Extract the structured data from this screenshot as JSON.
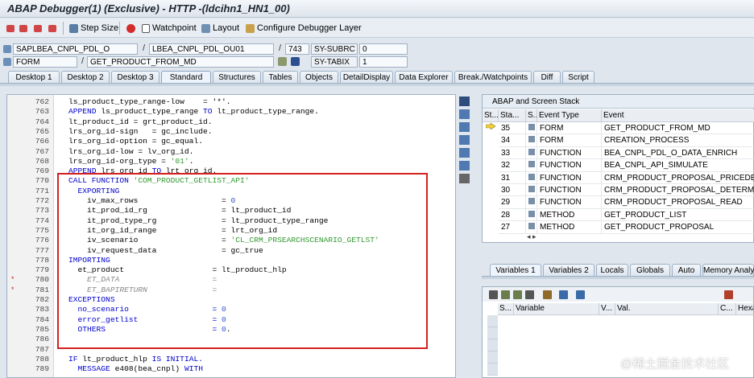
{
  "window": {
    "title": "ABAP Debugger(1)  (Exclusive) - HTTP -(ldcihn1_HN1_00)"
  },
  "toolbar": {
    "step_size": "Step Size",
    "watchpoint": "Watchpoint",
    "layout": "Layout",
    "configure": "Configure Debugger Layer"
  },
  "fields": {
    "program": "SAPLBEA_CNPL_PDL_O",
    "include": "LBEA_CNPL_PDL_OU01",
    "line": "743",
    "subrc_label": "SY-SUBRC",
    "subrc_value": "0",
    "event_type": "FORM",
    "event_name": "GET_PRODUCT_FROM_MD",
    "tabix_label": "SY-TABIX",
    "tabix_value": "1"
  },
  "tabs": [
    "Desktop 1",
    "Desktop 2",
    "Desktop 3",
    "Standard",
    "Structures",
    "Tables",
    "Objects",
    "DetailDisplay",
    "Data Explorer",
    "Break./Watchpoints",
    "Diff",
    "Script"
  ],
  "code": {
    "l762": "762",
    "t762": "ls_product_type_range-low    = '*'.",
    "l763": "763",
    "t763a": "APPEND",
    "t763b": " ls_product_type_range ",
    "t763c": "TO",
    "t763d": " lt_product_type_range.",
    "l764": "764",
    "t764": "lt_product_id = grt_product_id.",
    "l765": "765",
    "t765": "lrs_org_id-sign   = gc_include.",
    "l766": "766",
    "t766": "lrs_org_id-option = gc_equal.",
    "l767": "767",
    "t767": "lrs_org_id-low = lv_org_id.",
    "l768": "768",
    "t768a": "lrs_org_id-org_type = ",
    "t768b": "'01'",
    "t768c": ".",
    "l769": "769",
    "t769a": "APPEND",
    "t769b": " lrs_org_id ",
    "t769c": "TO",
    "t769d": " lrt_org_id.",
    "l770": "770",
    "t770a": "CALL FUNCTION",
    "t770b": " 'COM_PRODUCT_GETLIST_API'",
    "l771": "771",
    "t771": "  EXPORTING",
    "l772": "772",
    "t772a": "    iv_max_rows                  = ",
    "t772b": "0",
    "l773": "773",
    "t773": "    it_prod_id_rg                = lt_product_id",
    "l774": "774",
    "t774": "    it_prod_type_rg              = lt_product_type_range",
    "l775": "775",
    "t775": "    it_org_id_range              = lrt_org_id",
    "l776": "776",
    "t776a": "    iv_scenario                  = ",
    "t776b": "'CL_CRM_PRSEARCHSCENARIO_GETLST'",
    "l777": "777",
    "t777": "    iv_request_data              = gc_true",
    "l778": "778",
    "t778": "IMPORTING",
    "l779": "779",
    "t779": "  et_product                   = lt_product_hlp",
    "l780": "780",
    "t780": "    ET_DATA                    =",
    "l781": "781",
    "t781": "    ET_BAPIRETURN              =",
    "l782": "782",
    "t782": "EXCEPTIONS",
    "l783": "783",
    "t783a": "  no_scenario                  = ",
    "t783b": "0",
    "l784": "784",
    "t784a": "  error_getlist                = ",
    "t784b": "0",
    "l785": "785",
    "t785a": "  OTHERS                       = ",
    "t785b": "0",
    "t785c": ".",
    "l786": "786",
    "l787": "787",
    "l788": "788",
    "t788a": "IF",
    "t788b": " lt_product_hlp ",
    "t788c": "IS INITIAL.",
    "l789": "789",
    "t789a": "  MESSAGE",
    "t789b": " e408(bea_cnpl) ",
    "t789c": "WITH",
    "marker": "*"
  },
  "stack": {
    "title": "ABAP and Screen Stack",
    "headers": [
      "St...",
      "Sta...",
      "S...",
      "Event Type",
      "Event"
    ],
    "rows": [
      {
        "level": "35",
        "type": "FORM",
        "event": "GET_PRODUCT_FROM_MD"
      },
      {
        "level": "34",
        "type": "FORM",
        "event": "CREATION_PROCESS"
      },
      {
        "level": "33",
        "type": "FUNCTION",
        "event": "BEA_CNPL_PDL_O_DATA_ENRICH"
      },
      {
        "level": "32",
        "type": "FUNCTION",
        "event": "BEA_CNPL_API_SIMULATE"
      },
      {
        "level": "31",
        "type": "FUNCTION",
        "event": "CRM_PRODUCT_PROPOSAL_PRICEDET"
      },
      {
        "level": "30",
        "type": "FUNCTION",
        "event": "CRM_PRODUCT_PROPOSAL_DETERMINE"
      },
      {
        "level": "29",
        "type": "FUNCTION",
        "event": "CRM_PRODUCT_PROPOSAL_READ"
      },
      {
        "level": "28",
        "type": "METHOD",
        "event": "GET_PRODUCT_LIST"
      },
      {
        "level": "27",
        "type": "METHOD",
        "event": "GET_PRODUCT_PROPOSAL"
      }
    ],
    "scroll": "◂ ▸"
  },
  "var_tabs": [
    "Variables 1",
    "Variables 2",
    "Locals",
    "Globals",
    "Auto",
    "Memory Analy"
  ],
  "vars": {
    "headers": [
      "S...",
      "Variable",
      "V...",
      "Val.",
      "C...",
      "Hexade"
    ]
  },
  "watermark": "@稀土掘金技术社区",
  "colors": {
    "highlight_border": "#d42020",
    "keyword": "#0000cc",
    "string": "#339933"
  }
}
